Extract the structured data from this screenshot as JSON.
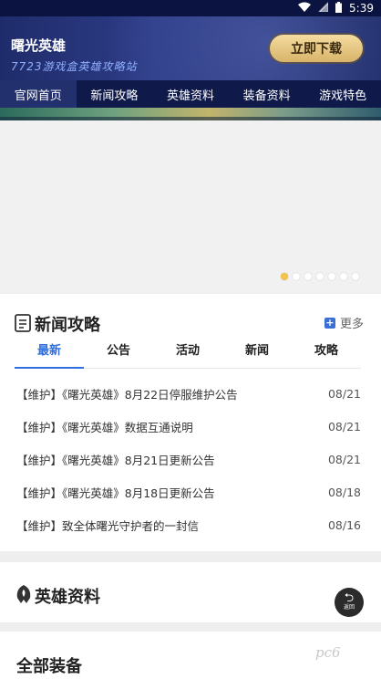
{
  "status_bar": {
    "time": "5:39"
  },
  "header": {
    "title": "曙光英雄",
    "subtitle": "7723游戏盒英雄攻略站",
    "download_label": "立即下载"
  },
  "nav": {
    "tabs": [
      {
        "label": "官网首页",
        "active": true
      },
      {
        "label": "新闻攻略"
      },
      {
        "label": "英雄资料"
      },
      {
        "label": "装备资料"
      },
      {
        "label": "游戏特色"
      }
    ]
  },
  "banner": {
    "slides": 7,
    "active_slide": 1
  },
  "news": {
    "title": "新闻攻略",
    "more_label": "更多",
    "tabs": [
      {
        "label": "最新",
        "active": true
      },
      {
        "label": "公告"
      },
      {
        "label": "活动"
      },
      {
        "label": "新闻"
      },
      {
        "label": "攻略"
      }
    ],
    "items": [
      {
        "title": "【维护】《曙光英雄》8月22日停服维护公告",
        "date": "08/21"
      },
      {
        "title": "【维护】《曙光英雄》数据互通说明",
        "date": "08/21"
      },
      {
        "title": "【维护】《曙光英雄》8月21日更新公告",
        "date": "08/21"
      },
      {
        "title": "【维护】《曙光英雄》8月18日更新公告",
        "date": "08/18"
      },
      {
        "title": "【维护】致全体曙光守护者的一封信",
        "date": "08/16"
      }
    ]
  },
  "hero": {
    "title": "英雄资料",
    "back_label": "返回"
  },
  "equipment": {
    "title": "全部装备"
  },
  "watermark": {
    "text": "pc6"
  },
  "colors": {
    "accent": "#2f6fe0",
    "header_bg": "#1f2c6b",
    "button_gold": "#e8c77e",
    "dot_active": "#f3c24a"
  }
}
